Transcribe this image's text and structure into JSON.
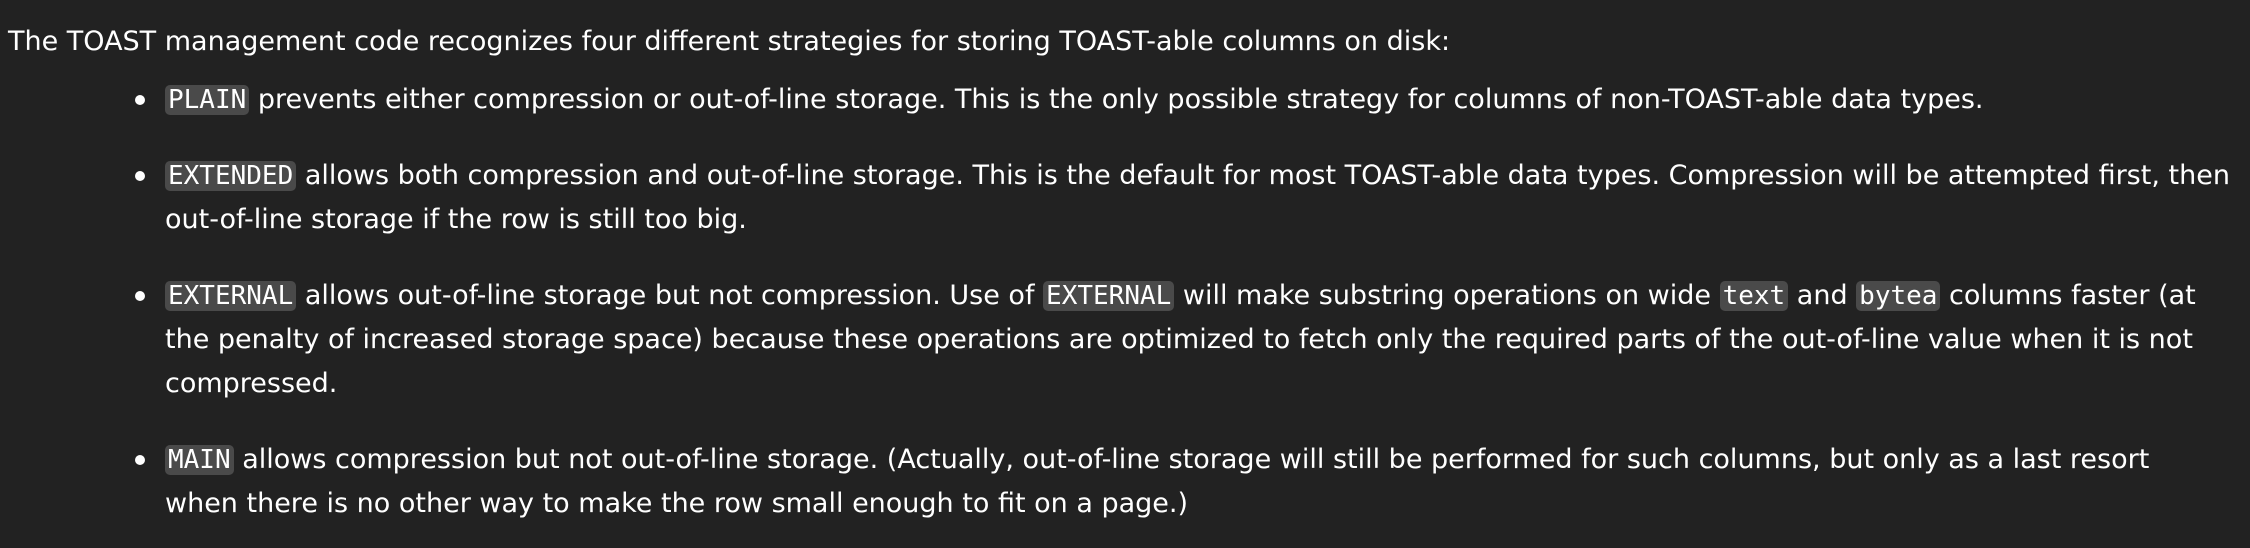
{
  "intro": "The TOAST management code recognizes four different strategies for storing TOAST-able columns on disk:",
  "items": [
    {
      "code1": "PLAIN",
      "text1": " prevents either compression or out-of-line storage. This is the only possible strategy for columns of non-TOAST-able data types."
    },
    {
      "code1": "EXTENDED",
      "text1": " allows both compression and out-of-line storage. This is the default for most TOAST-able data types. Compression will be attempted first, then out-of-line storage if the row is still too big."
    },
    {
      "code1": "EXTERNAL",
      "text1": " allows out-of-line storage but not compression. Use of ",
      "code2": "EXTERNAL",
      "text2": " will make substring operations on wide ",
      "code3": "text",
      "text3": " and ",
      "code4": "bytea",
      "text4": " columns faster (at the penalty of increased storage space) because these operations are optimized to fetch only the required parts of the out-of-line value when it is not compressed."
    },
    {
      "code1": "MAIN",
      "text1": " allows compression but not out-of-line storage. (Actually, out-of-line storage will still be performed for such columns, but only as a last resort when there is no other way to make the row small enough to fit on a page.)"
    }
  ]
}
